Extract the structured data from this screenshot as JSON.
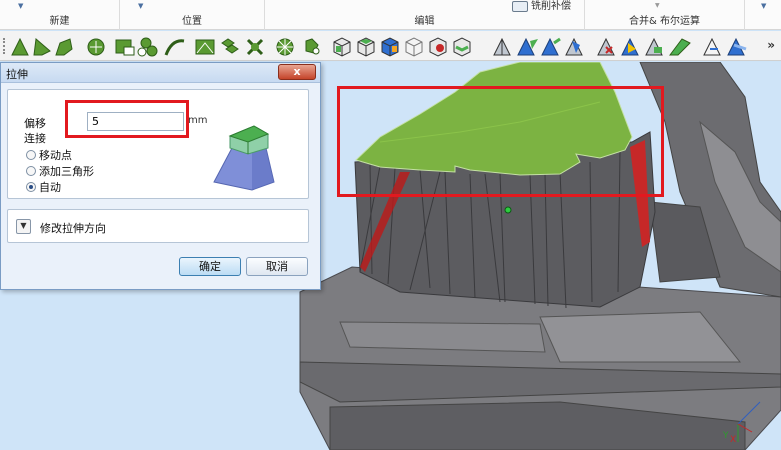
{
  "ribbon": {
    "groups": [
      {
        "label": "新建"
      },
      {
        "label": "位置"
      },
      {
        "label": "编辑"
      },
      {
        "label": "合并& 布尔运算"
      }
    ],
    "mill_button": "铣削补偿"
  },
  "toolbar": {
    "more": "»"
  },
  "dialog": {
    "title": "拉伸",
    "close": "x",
    "offset_label": "偏移",
    "offset_value": "5",
    "unit": "mm",
    "connect_label": "连接",
    "options": [
      {
        "label": "移动点",
        "selected": false
      },
      {
        "label": "添加三角形",
        "selected": false
      },
      {
        "label": "自动",
        "selected": true
      }
    ],
    "direction_label": "修改拉伸方向",
    "ok_label": "确定",
    "cancel_label": "取消"
  },
  "viewport": {
    "axis_x": "X",
    "axis_y": "Y"
  },
  "colors": {
    "highlight": "#e2191f",
    "mesh_green": "#7cb342",
    "mesh_gray": "#6f6f73",
    "background": "#cfe4f8"
  }
}
